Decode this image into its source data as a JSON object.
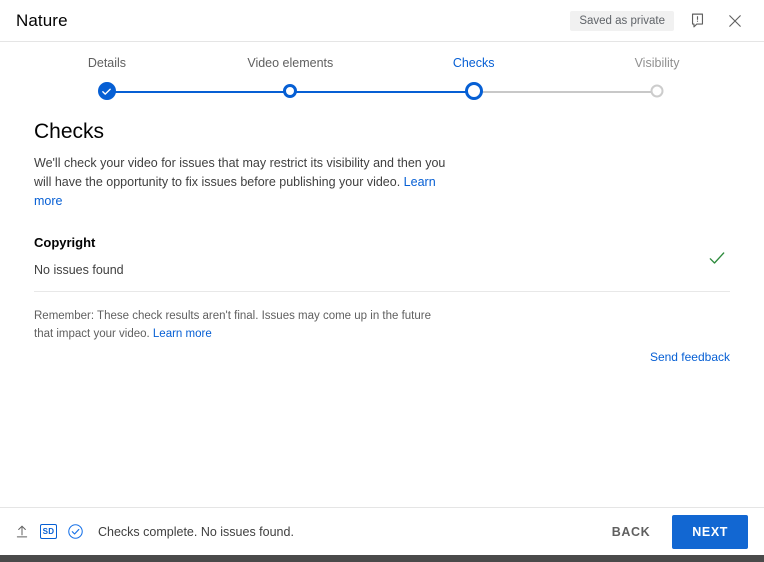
{
  "header": {
    "title": "Nature",
    "save_status": "Saved as private",
    "feedback_icon": "feedback-flag-icon",
    "close_icon": "close-icon"
  },
  "stepper": {
    "steps": [
      {
        "label": "Details",
        "state": "done",
        "pct": 14
      },
      {
        "label": "Video elements",
        "state": "complete-ring",
        "pct": 38
      },
      {
        "label": "Checks",
        "state": "active",
        "pct": 62
      },
      {
        "label": "Visibility",
        "state": "pending",
        "pct": 86
      }
    ]
  },
  "main": {
    "title": "Checks",
    "description": "We'll check your video for issues that may restrict its visibility and then you will have the opportunity to fix issues before publishing your video.",
    "description_link": "Learn more",
    "check": {
      "name": "Copyright",
      "result": "No issues found",
      "status_icon": "green-checkmark-icon",
      "status_color": "#2e8b3d"
    },
    "remember_note": "Remember: These check results aren't final. Issues may come up in the future that impact your video.",
    "remember_link": "Learn more",
    "send_feedback": "Send feedback"
  },
  "footer": {
    "upload_icon": "upload-arrow-icon",
    "quality_badge": "SD",
    "checks_icon": "check-circle-icon",
    "status": "Checks complete. No issues found.",
    "back_label": "BACK",
    "next_label": "NEXT"
  },
  "colors": {
    "accent": "#065fd4",
    "primary_button": "#1267d2",
    "success": "#2e8b3d",
    "bottom_bar": "#4a4a4a"
  }
}
